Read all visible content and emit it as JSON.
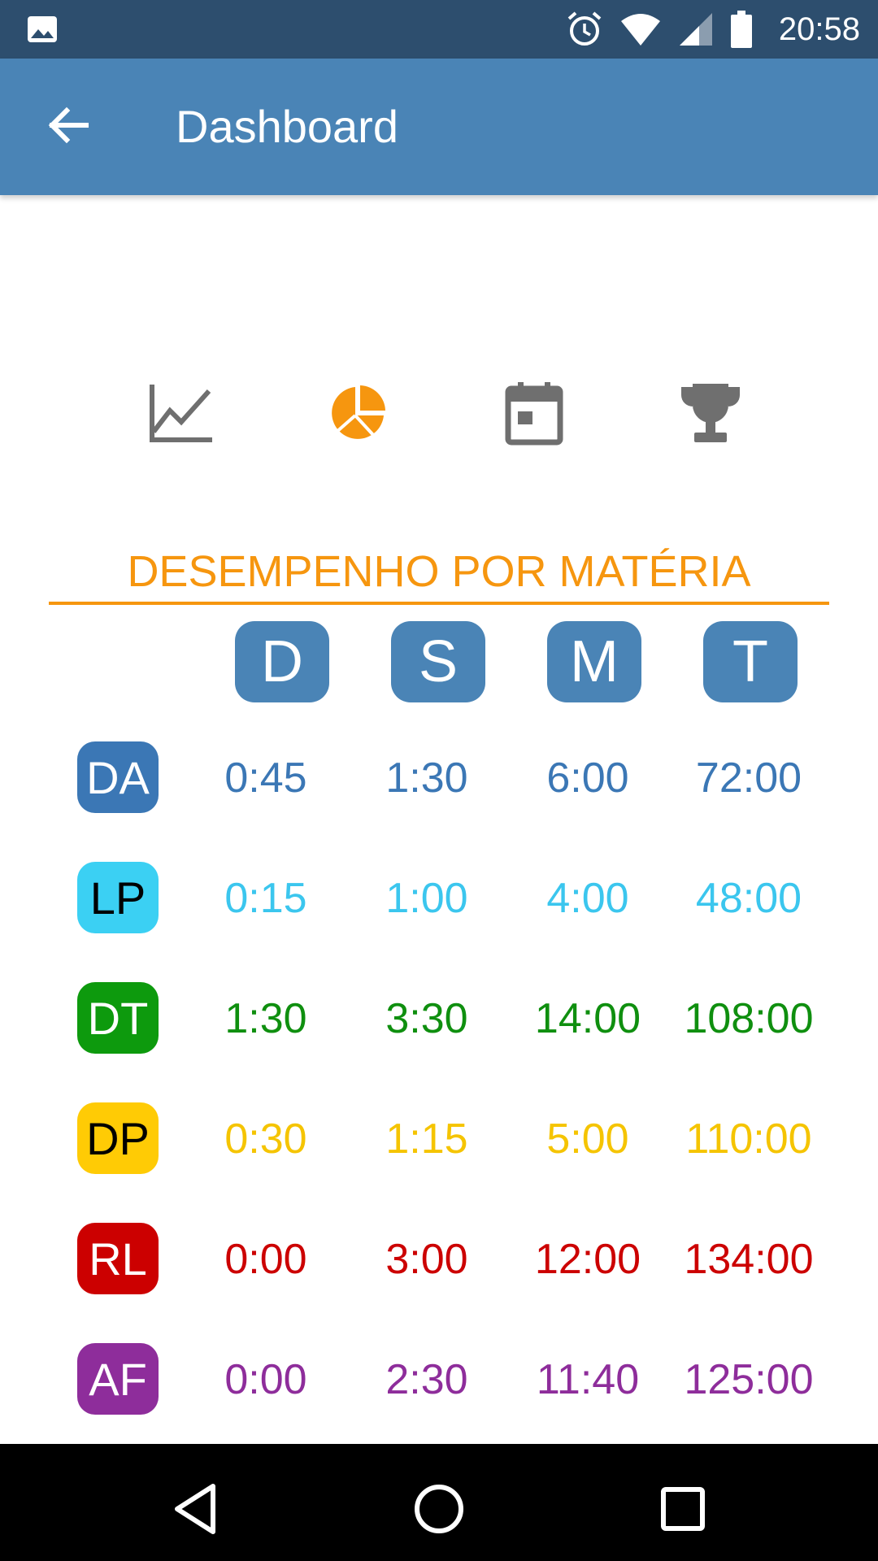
{
  "status_bar": {
    "time": "20:58",
    "icons": [
      "image-icon",
      "alarm-icon",
      "wifi-icon",
      "signal-icon",
      "battery-icon"
    ]
  },
  "app_bar": {
    "title": "Dashboard",
    "back_icon": "arrow-back-icon"
  },
  "tabs": [
    {
      "name": "line-chart-icon",
      "active": false
    },
    {
      "name": "pie-chart-icon",
      "active": true
    },
    {
      "name": "calendar-icon",
      "active": false
    },
    {
      "name": "trophy-icon",
      "active": false
    }
  ],
  "section": {
    "title": "DESEMPENHO POR MATÉRIA",
    "accent": "#f6960f"
  },
  "columns": [
    "D",
    "S",
    "M",
    "T"
  ],
  "rows": [
    {
      "code": "DA",
      "badge_bg": "#3b77b5",
      "badge_fg": "#ffffff",
      "color": "#3b77b5",
      "values": [
        "0:45",
        "1:30",
        "6:00",
        "72:00"
      ]
    },
    {
      "code": "LP",
      "badge_bg": "#3bd0f3",
      "badge_fg": "#000000",
      "color": "#3bc6ee",
      "values": [
        "0:15",
        "1:00",
        "4:00",
        "48:00"
      ]
    },
    {
      "code": "DT",
      "badge_bg": "#0d9a0d",
      "badge_fg": "#ffffff",
      "color": "#0f8f0f",
      "values": [
        "1:30",
        "3:30",
        "14:00",
        "108:00"
      ]
    },
    {
      "code": "DP",
      "badge_bg": "#ffcb05",
      "badge_fg": "#000000",
      "color": "#f5c400",
      "values": [
        "0:30",
        "1:15",
        "5:00",
        "110:00"
      ]
    },
    {
      "code": "RL",
      "badge_bg": "#cc0000",
      "badge_fg": "#ffffff",
      "color": "#cc0000",
      "values": [
        "0:00",
        "3:00",
        "12:00",
        "134:00"
      ]
    },
    {
      "code": "AF",
      "badge_bg": "#8e2d9b",
      "badge_fg": "#ffffff",
      "color": "#8e2d9b",
      "values": [
        "0:00",
        "2:30",
        "11:40",
        "125:00"
      ]
    }
  ],
  "nav_bar": {
    "buttons": [
      "back-triangle-icon",
      "home-circle-icon",
      "recents-square-icon"
    ]
  }
}
